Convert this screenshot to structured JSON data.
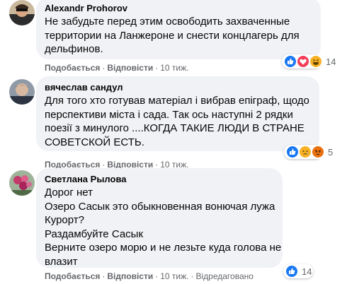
{
  "comments": [
    {
      "author": "Alexandr Prohorov",
      "lines": [
        "Не забудьте перед этим освободить захваченные",
        "территории на Ланжероне и снести концлагерь для",
        "дельфинов."
      ],
      "like_label": "Подобається",
      "reply_label": "Відповісти",
      "time": "10 тиж.",
      "reactions": [
        "like",
        "love",
        "haha"
      ],
      "reaction_count": "14"
    },
    {
      "author": "вячеслав сандул",
      "lines": [
        "Для того хто готував матеріал і вибрав епіграф, щодо",
        "перспективи міста і сада. Так ось наступні 2 рядки",
        "поезії з минулого ....КОГДА ТАКИЕ ЛЮДИ В СТРАНЕ",
        "СОВЕТСКОЙ ЕСТЬ."
      ],
      "like_label": "Подобається",
      "reply_label": "Відповісти",
      "time": "10 тиж.",
      "reactions": [
        "like",
        "sad",
        "angry"
      ],
      "reaction_count": "5"
    },
    {
      "author": "Светлана Рылова",
      "lines": [
        "Дорог нет",
        "Озеро Сасык это обыкновенная вонючая лужа",
        "Курорт?",
        "Раздамбуйте Сасык",
        "Верните озеро морю и не лезьте куда голова не",
        "влазит"
      ],
      "like_label": "Подобається",
      "reply_label": "Відповісти",
      "time": "10 тиж.",
      "edited_label": "Відредаговано",
      "reactions": [
        "like"
      ],
      "reaction_count": "14"
    }
  ],
  "colors": {
    "like": "#1877f2",
    "love": "#f33e58",
    "haha": "#f7b125",
    "sad": "#f7b125",
    "angry": "#e9710f",
    "bubble": "#f0f2f5",
    "meta": "#65676b"
  }
}
